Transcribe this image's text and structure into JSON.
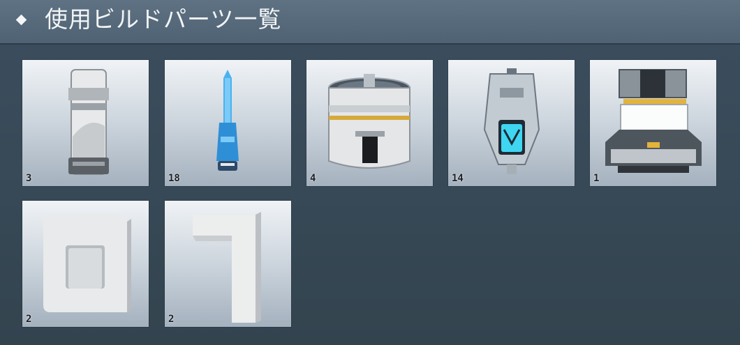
{
  "header": {
    "title": "使用ビルドパーツ一覧",
    "bullet_icon": "diamond-bullet-icon"
  },
  "parts": [
    {
      "id": "part-1",
      "icon": "tall-bracket-part-icon",
      "count": "3"
    },
    {
      "id": "part-2",
      "icon": "blue-antenna-part-icon",
      "count": "18"
    },
    {
      "id": "part-3",
      "icon": "cylinder-hatch-part-icon",
      "count": "4"
    },
    {
      "id": "part-4",
      "icon": "thruster-part-icon",
      "count": "14"
    },
    {
      "id": "part-5",
      "icon": "cargo-box-part-icon",
      "count": "1"
    },
    {
      "id": "part-6",
      "icon": "digit-zero-part-icon",
      "count": "2"
    },
    {
      "id": "part-7",
      "icon": "digit-one-part-icon",
      "count": "2"
    }
  ],
  "colors": {
    "background": "#34495a",
    "header": "#566a7b",
    "tile": "#d5dde5",
    "accent_blue": "#3aa0e8",
    "accent_yellow": "#e8b83a"
  }
}
